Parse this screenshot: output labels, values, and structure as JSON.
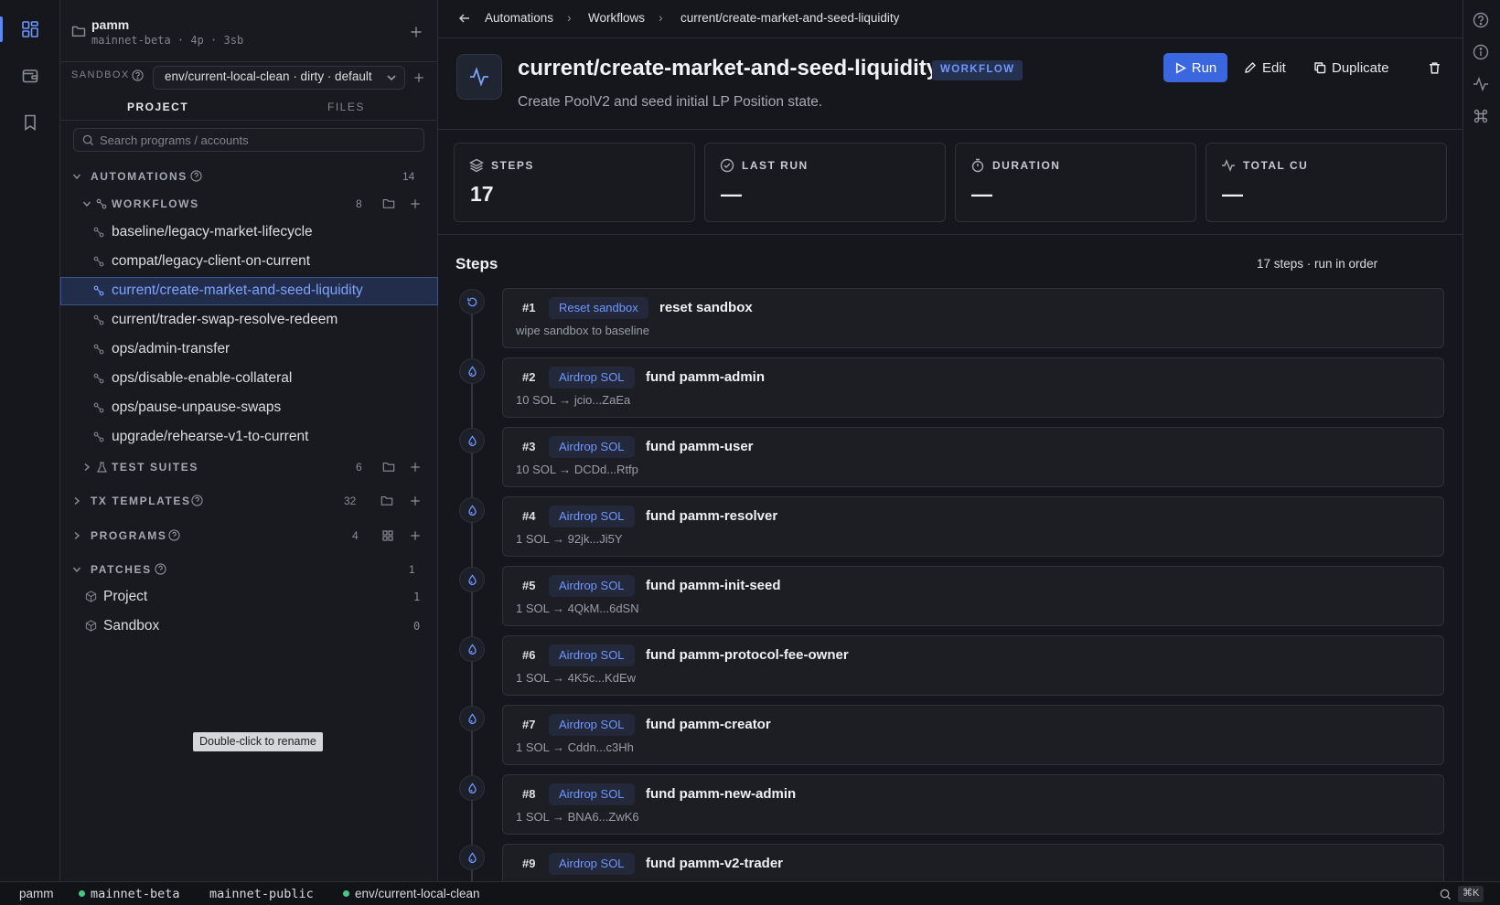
{
  "activity": {
    "items": [
      "dashboard-icon",
      "wallet-icon",
      "bookmark-icon"
    ],
    "active": "dashboard-icon"
  },
  "project": {
    "name": "pamm",
    "meta": "mainnet-beta · 4p · 3sb"
  },
  "sandbox": {
    "label": "SANDBOX",
    "value": "env/current-local-clean · dirty · default"
  },
  "tabs": {
    "project": "PROJECT",
    "files": "FILES"
  },
  "search": {
    "placeholder": "Search programs / accounts"
  },
  "sections": {
    "automations": {
      "label": "AUTOMATIONS",
      "count": "14"
    },
    "workflows": {
      "label": "WORKFLOWS",
      "count": "8"
    },
    "test_suites": {
      "label": "TEST SUITES",
      "count": "6"
    },
    "tx_templates": {
      "label": "TX TEMPLATES",
      "count": "32"
    },
    "programs": {
      "label": "PROGRAMS",
      "count": "4"
    },
    "patches": {
      "label": "PATCHES",
      "count": "1"
    }
  },
  "workflows": [
    "baseline/legacy-market-lifecycle",
    "compat/legacy-client-on-current",
    "current/create-market-and-seed-liquidity",
    "current/trader-swap-resolve-redeem",
    "ops/admin-transfer",
    "ops/disable-enable-collateral",
    "ops/pause-unpause-swaps",
    "upgrade/rehearse-v1-to-current"
  ],
  "patches": [
    {
      "name": "Project",
      "count": "1"
    },
    {
      "name": "Sandbox",
      "count": "0"
    }
  ],
  "tooltip": "Double-click to rename",
  "breadcrumb": [
    "Automations",
    "Workflows",
    "current/create-market-and-seed-liquidity"
  ],
  "workflow": {
    "title": "current/create-market-and-seed-liquidity",
    "badge": "WORKFLOW",
    "description": "Create PoolV2 and seed initial LP Position state."
  },
  "actions": {
    "run": "Run",
    "edit": "Edit",
    "duplicate": "Duplicate"
  },
  "stats": [
    {
      "label": "STEPS",
      "value": "17",
      "icon": "layers-icon"
    },
    {
      "label": "LAST RUN",
      "value": "—",
      "icon": "check-circle-icon"
    },
    {
      "label": "DURATION",
      "value": "—",
      "icon": "timer-icon"
    },
    {
      "label": "TOTAL CU",
      "value": "—",
      "icon": "activity-icon"
    }
  ],
  "steps_section": {
    "title": "Steps",
    "meta": "17 steps · run in order"
  },
  "steps": [
    {
      "num": "#1",
      "type": "Reset sandbox",
      "name": "reset sandbox",
      "detail": "wipe sandbox to baseline"
    },
    {
      "num": "#2",
      "type": "Airdrop SOL",
      "name": "fund pamm-admin",
      "detail": "10 SOL → jcio...ZaEa"
    },
    {
      "num": "#3",
      "type": "Airdrop SOL",
      "name": "fund pamm-user",
      "detail": "10 SOL → DCDd...Rtfp"
    },
    {
      "num": "#4",
      "type": "Airdrop SOL",
      "name": "fund pamm-resolver",
      "detail": "1 SOL → 92jk...Ji5Y"
    },
    {
      "num": "#5",
      "type": "Airdrop SOL",
      "name": "fund pamm-init-seed",
      "detail": "1 SOL → 4QkM...6dSN"
    },
    {
      "num": "#6",
      "type": "Airdrop SOL",
      "name": "fund pamm-protocol-fee-owner",
      "detail": "1 SOL → 4K5c...KdEw"
    },
    {
      "num": "#7",
      "type": "Airdrop SOL",
      "name": "fund pamm-creator",
      "detail": "1 SOL → Cddn...c3Hh"
    },
    {
      "num": "#8",
      "type": "Airdrop SOL",
      "name": "fund pamm-new-admin",
      "detail": "1 SOL → BNA6...ZwK6"
    },
    {
      "num": "#9",
      "type": "Airdrop SOL",
      "name": "fund pamm-v2-trader",
      "detail": ""
    }
  ],
  "statusbar": {
    "project": "pamm",
    "cluster": "mainnet-beta",
    "rpc": "mainnet-public",
    "env": "env/current-local-clean",
    "shortcut": "⌘K"
  },
  "colors": {
    "accent": "#3a67e0",
    "accent_text": "#6f97ff",
    "ok": "#46c785"
  }
}
